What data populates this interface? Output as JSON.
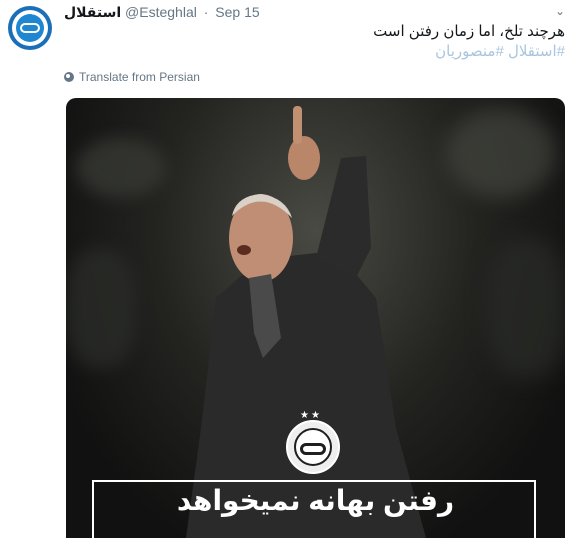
{
  "tweet": {
    "display_name": "استقلال",
    "handle": "@Esteghlal",
    "separator": "·",
    "date": "Sep 15",
    "text": "هرچند تلخ، اما زمان رفتن است",
    "hashtags": "#استقلال #منصوریان",
    "translate_label": "Translate from Persian",
    "media": {
      "caption": "رفتن بهانه نمیخواهد",
      "badge_stars": "★★"
    }
  },
  "colors": {
    "text": "#14171a",
    "muted": "#657786",
    "hashtag": "#a8c6e0",
    "brand_blue": "#1f86d1"
  },
  "icons": {
    "more": "chevron-down-icon",
    "translate": "globe-icon",
    "avatar": "esteghlal-logo"
  }
}
